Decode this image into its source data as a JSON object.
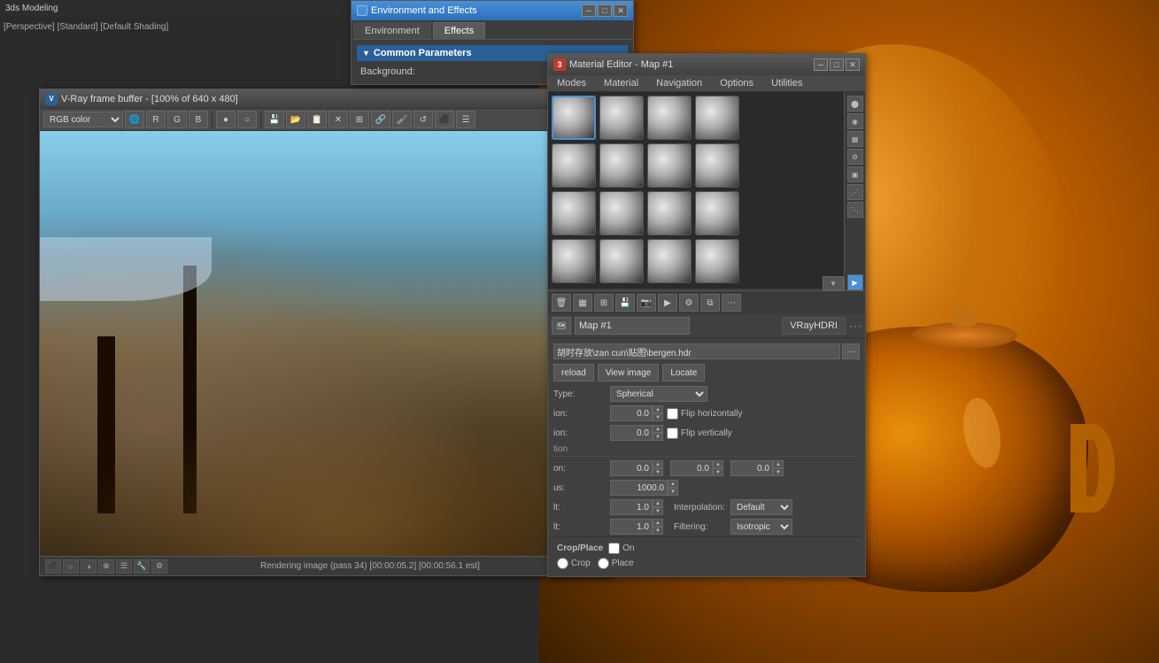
{
  "app": {
    "title": "3ds Modeling",
    "viewport_label": "[Perspective] [Standard] [Default Shading]"
  },
  "env_effects_window": {
    "title": "Environment and Effects",
    "tabs": [
      "Environment",
      "Effects"
    ],
    "active_tab": "Effects",
    "section_title": "Common Parameters",
    "background_label": "Background:"
  },
  "vray_window": {
    "title": "V-Ray frame buffer - [100% of 640 x 480]",
    "icon_label": "V",
    "color_mode": "RGB color",
    "status_text": "Rendering image (pass 34) [00:00:05.2] [00:00:56.1 est]",
    "toolbar_buttons": [
      "R",
      "G",
      "B",
      "●",
      "○",
      "💾",
      "📋",
      "📷",
      "✕",
      "⊞",
      "🔗",
      "🖌",
      "↺",
      "⬜",
      "☰"
    ]
  },
  "material_editor": {
    "title": "Material Editor - Map #1",
    "badge": "3",
    "menus": [
      "Modes",
      "Material",
      "Navigation",
      "Options",
      "Utilities"
    ],
    "map_name": "Map #1",
    "map_type": "VRayHDRI",
    "filepath": "胡时存放\\zan cun\\贴图\\bergen.hdr",
    "buttons": {
      "reload": "reload",
      "view_image": "View image",
      "locate": "Locate"
    },
    "type_label": "Type:",
    "type_value": "Spherical",
    "horiz_rotation_label": "ion:",
    "horiz_rotation_value": "0.0",
    "vert_rotation_label": "ion:",
    "vert_rotation_value": "0.0",
    "flip_h_label": "Flip horizontally",
    "flip_v_label": "Flip vertically",
    "offset_section": "tion",
    "offset_u_label": "on:",
    "offset_u_value": "0.0",
    "offset_v_value": "0.0",
    "offset_w_value": "0.0",
    "radius_label": "us:",
    "radius_value": "1000.0",
    "overall_label": "lt:",
    "overall_value": "1.0",
    "render_label": "lt:",
    "render_value": "1.0",
    "interpolation_label": "Interpolation:",
    "interpolation_value": "Default",
    "filtering_label": "Filtering:",
    "filtering_value": "Isotropic",
    "crop_place_label": "Crop/Place",
    "crop_label": "On",
    "crop_radio": "Crop",
    "place_radio": "Place"
  },
  "spheres": {
    "count": 16,
    "rows": 4,
    "cols": 4,
    "selected_index": 0
  },
  "icons": {
    "minimize": "─",
    "maximize": "□",
    "close": "✕",
    "arrow_right": "▶",
    "arrow_down": "▼",
    "arrow_left": "◀",
    "spin_up": "▲",
    "spin_down": "▼",
    "dots": "⋯",
    "trash": "🗑",
    "save": "💾",
    "camera": "📷"
  }
}
